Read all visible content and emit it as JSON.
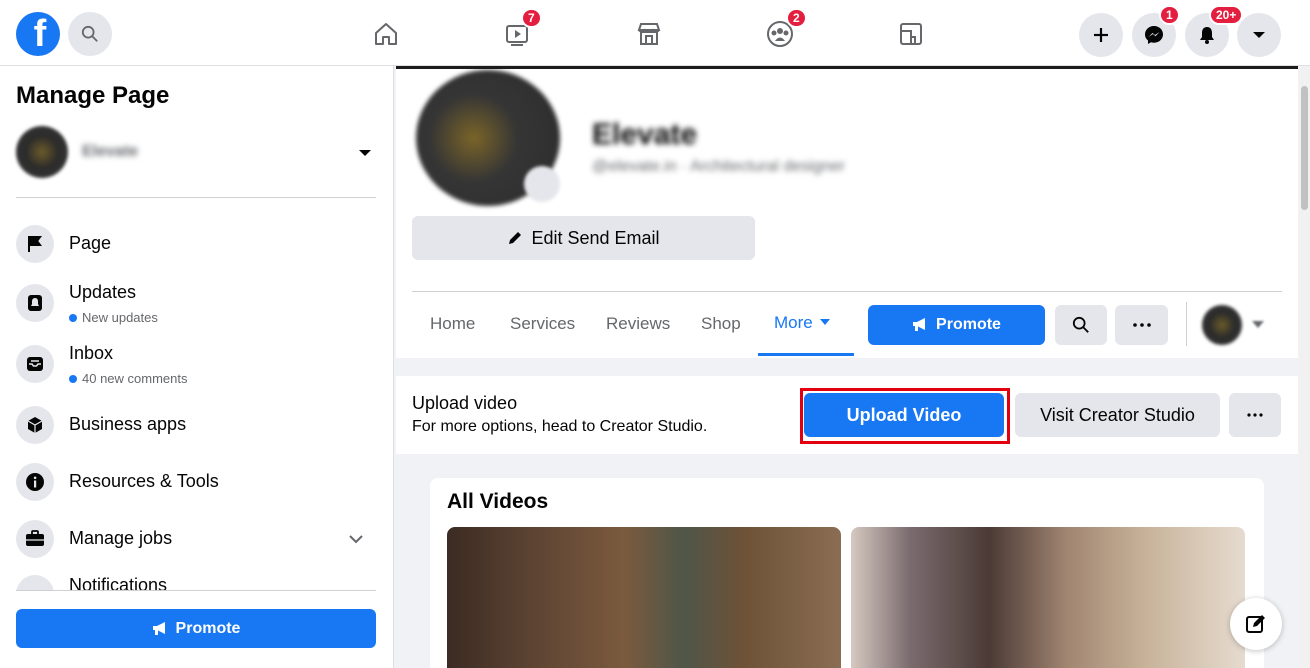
{
  "topbar": {
    "logo": "f",
    "badges": {
      "watch": "7",
      "groups": "2",
      "messenger": "1",
      "notifications": "20+"
    }
  },
  "sidebar": {
    "title": "Manage Page",
    "page_name": "Elevate",
    "items": [
      {
        "label": "Page",
        "icon": "flag-icon"
      },
      {
        "label": "Updates",
        "sub": "New updates",
        "icon": "bell-icon"
      },
      {
        "label": "Inbox",
        "sub": "40 new comments",
        "icon": "inbox-icon"
      },
      {
        "label": "Business apps",
        "icon": "cube-icon"
      },
      {
        "label": "Resources & Tools",
        "icon": "info-icon"
      },
      {
        "label": "Manage jobs",
        "icon": "briefcase-icon"
      },
      {
        "label": "Notifications",
        "icon": "bell-icon"
      }
    ],
    "promote_label": "Promote"
  },
  "profile": {
    "name": "Elevate",
    "handle": "@elevate.in · Architectural designer",
    "edit_label": "Edit Send Email",
    "tabs": [
      "Home",
      "Services",
      "Reviews",
      "Shop",
      "More"
    ],
    "promote_label": "Promote"
  },
  "upload": {
    "title": "Upload video",
    "subtitle": "For more options, head to Creator Studio.",
    "upload_label": "Upload Video",
    "creator_label": "Visit Creator Studio"
  },
  "videos": {
    "title": "All Videos"
  },
  "colors": {
    "brand": "#1877f2",
    "highlight": "#e2000f",
    "badge": "#e41e3f"
  }
}
